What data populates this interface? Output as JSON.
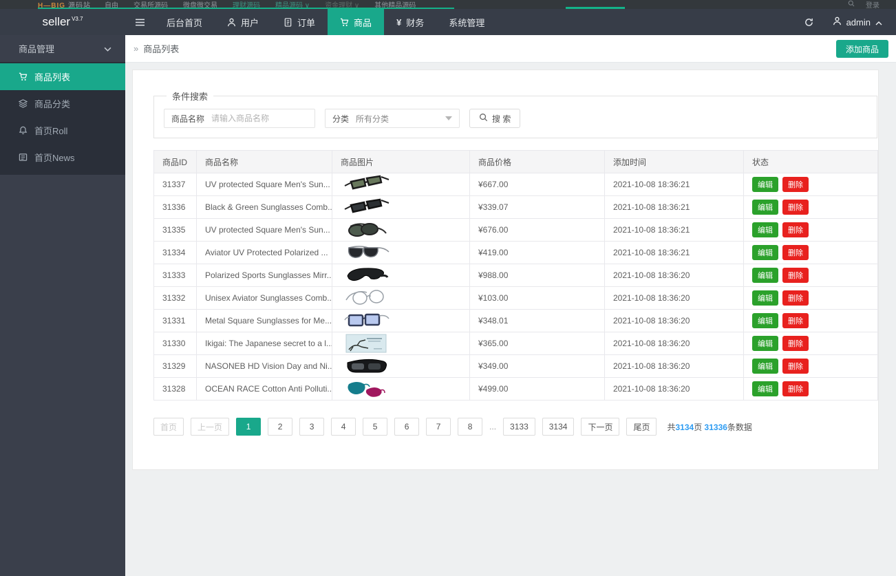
{
  "browser_strip": {
    "logo_mark": "H—BIG",
    "logo_suffix": "源码站",
    "items": [
      {
        "label": "自由",
        "style": "normal"
      },
      {
        "label": "交易所源码",
        "style": "normal"
      },
      {
        "label": "微盘微交易",
        "style": "normal"
      },
      {
        "label": "理财源码",
        "style": "teal"
      },
      {
        "label": "精品源码 ∨",
        "style": "teal"
      },
      {
        "label": "资金理财 ∨",
        "style": "muted"
      },
      {
        "label": "其他精品源码",
        "style": "normal"
      }
    ],
    "login": "登录"
  },
  "navbar": {
    "brand": "seller",
    "brand_version": "V3.7",
    "items": [
      {
        "key": "dashboard",
        "label": "后台首页",
        "icon": null,
        "active": false
      },
      {
        "key": "users",
        "label": "用户",
        "icon": "user",
        "active": false
      },
      {
        "key": "orders",
        "label": "订单",
        "icon": "doc",
        "active": false
      },
      {
        "key": "goods",
        "label": "商品",
        "icon": "cart",
        "active": true
      },
      {
        "key": "finance",
        "label": "财务",
        "icon": "yen",
        "active": false
      },
      {
        "key": "system",
        "label": "系统管理",
        "icon": null,
        "active": false
      }
    ],
    "admin": "admin"
  },
  "sidebar": {
    "section": "商品管理",
    "items": [
      {
        "key": "goods-list",
        "label": "商品列表",
        "icon": "cart",
        "active": true
      },
      {
        "key": "goods-category",
        "label": "商品分类",
        "icon": "layers",
        "active": false
      },
      {
        "key": "home-roll",
        "label": "首页Roll",
        "icon": "bell",
        "active": false
      },
      {
        "key": "home-news",
        "label": "首页News",
        "icon": "news",
        "active": false
      }
    ]
  },
  "breadcrumb": {
    "arrow": "»",
    "current": "商品列表"
  },
  "add_button": "添加商品",
  "search": {
    "legend": "条件搜索",
    "name_label": "商品名称",
    "name_placeholder": "请输入商品名称",
    "category_label": "分类",
    "category_value": "所有分类",
    "button": "搜 索"
  },
  "table": {
    "headers": [
      "商品ID",
      "商品名称",
      "商品图片",
      "商品价格",
      "添加时间",
      "状态"
    ],
    "edit_label": "编辑",
    "delete_label": "删除",
    "rows": [
      {
        "id": "31337",
        "name": "UV protected Square Men's Sun...",
        "image": "sg_angled_green",
        "price": "¥667.00",
        "time": "2021-10-08 18:36:21"
      },
      {
        "id": "31336",
        "name": "Black & Green Sunglasses Comb...",
        "image": "sg_angled_dark",
        "price": "¥339.07",
        "time": "2021-10-08 18:36:21"
      },
      {
        "id": "31335",
        "name": "UV protected Square Men's Sun...",
        "image": "sg_folded",
        "price": "¥676.00",
        "time": "2021-10-08 18:36:21"
      },
      {
        "id": "31334",
        "name": "Aviator UV Protected Polarized ...",
        "image": "aviator",
        "price": "¥419.00",
        "time": "2021-10-08 18:36:21"
      },
      {
        "id": "31333",
        "name": "Polarized Sports Sunglasses Mirr...",
        "image": "sport",
        "price": "¥988.00",
        "time": "2021-10-08 18:36:20"
      },
      {
        "id": "31332",
        "name": "Unisex Aviator Sunglasses Comb...",
        "image": "wireframe",
        "price": "¥103.00",
        "time": "2021-10-08 18:36:20"
      },
      {
        "id": "31331",
        "name": "Metal Square Sunglasses for Me...",
        "image": "square_blue",
        "price": "¥348.01",
        "time": "2021-10-08 18:36:20"
      },
      {
        "id": "31330",
        "name": "Ikigai: The Japanese secret to a l...",
        "image": "book",
        "price": "¥365.00",
        "time": "2021-10-08 18:36:20"
      },
      {
        "id": "31329",
        "name": "NASONEB HD Vision Day and Ni...",
        "image": "wrap_black",
        "price": "¥349.00",
        "time": "2021-10-08 18:36:20"
      },
      {
        "id": "31328",
        "name": "OCEAN RACE Cotton Anti Polluti...",
        "image": "masks",
        "price": "¥499.00",
        "time": "2021-10-08 18:36:20"
      }
    ]
  },
  "pagination": {
    "first": "首页",
    "prev": "上一页",
    "pages": [
      "1",
      "2",
      "3",
      "4",
      "5",
      "6",
      "7",
      "8"
    ],
    "active_page": "1",
    "ellipsis": "...",
    "tail_pages": [
      "3133",
      "3134"
    ],
    "next": "下一页",
    "last": "尾页",
    "summary": {
      "prefix": "共",
      "total_pages": "3134",
      "pages_suffix": "页 ",
      "total_records": "31336",
      "records_suffix": "条数据"
    }
  },
  "colors": {
    "accent_teal": "#19a88b",
    "navbar_bg": "#373d48",
    "sidebar_bg": "#3a3f4b",
    "sidebar_submenu_bg": "#2a2f39",
    "edit_green": "#2ba12b",
    "delete_red": "#e8211e",
    "link_blue": "#2e9cf2"
  }
}
